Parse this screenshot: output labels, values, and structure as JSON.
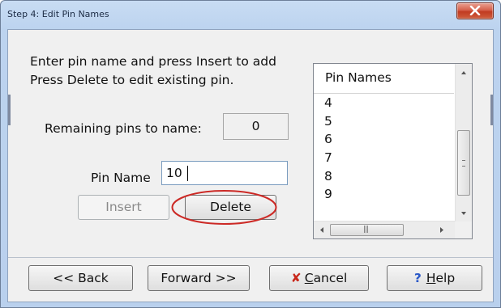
{
  "window": {
    "title": "Step 4: Edit Pin Names"
  },
  "instructions": {
    "line1": "Enter pin name and press Insert to add",
    "line2": "Press Delete to edit existing pin."
  },
  "remaining": {
    "label": "Remaining pins to name:",
    "value": "0"
  },
  "pin_name": {
    "label": "Pin Name",
    "value": "10"
  },
  "actions": {
    "insert_label": "Insert",
    "delete_label": "Delete"
  },
  "pin_list": {
    "header": "Pin Names",
    "items": [
      "4",
      "5",
      "6",
      "7",
      "8",
      "9"
    ]
  },
  "footer": {
    "back_label": "<< Back",
    "forward_label": "Forward >>",
    "cancel_prefix": "C",
    "cancel_rest": "ancel",
    "help_prefix": "H",
    "help_rest": "elp"
  },
  "icons": {
    "close": "close-icon",
    "cancel": "x-icon",
    "help": "question-icon",
    "highlight": "red-ellipse-annotation"
  },
  "colors": {
    "titlebar": "#bcd3ef",
    "close_button": "#c13b21",
    "cancel_icon": "#c8281b",
    "help_icon": "#2b59c8",
    "annotation": "#cc2a26"
  }
}
